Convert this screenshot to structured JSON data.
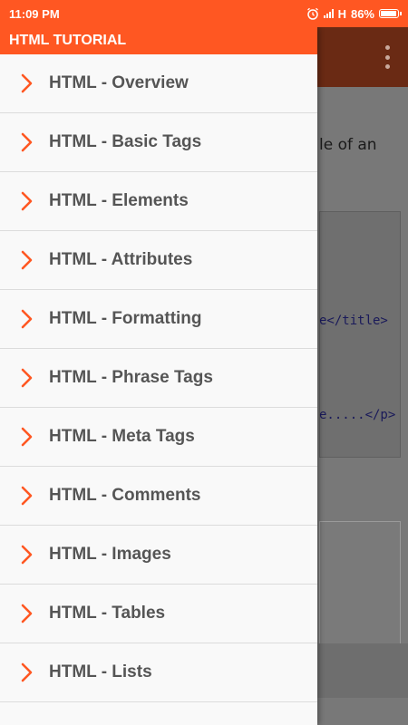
{
  "status_bar": {
    "time": "11:09 PM",
    "network": "H",
    "battery": "86%",
    "battery_level": 0.86,
    "icons": [
      "alarm-icon",
      "signal-icon",
      "battery-icon"
    ]
  },
  "drawer": {
    "title": "HTML TUTORIAL",
    "items": [
      {
        "label": "HTML - Overview"
      },
      {
        "label": "HTML - Basic Tags"
      },
      {
        "label": "HTML - Elements"
      },
      {
        "label": "HTML - Attributes"
      },
      {
        "label": "HTML - Formatting"
      },
      {
        "label": "HTML - Phrase Tags"
      },
      {
        "label": "HTML - Meta Tags"
      },
      {
        "label": "HTML - Comments"
      },
      {
        "label": "HTML - Images"
      },
      {
        "label": "HTML - Tables"
      },
      {
        "label": "HTML - Lists"
      }
    ]
  },
  "background": {
    "text_fragment": "le of an",
    "code_lines": [
      "e</title>",
      "e.....</p>"
    ]
  },
  "colors": {
    "accent": "#ff5722",
    "chevron": "#ff5722",
    "drawer_bg": "#f9f9f9",
    "label": "#555555"
  }
}
